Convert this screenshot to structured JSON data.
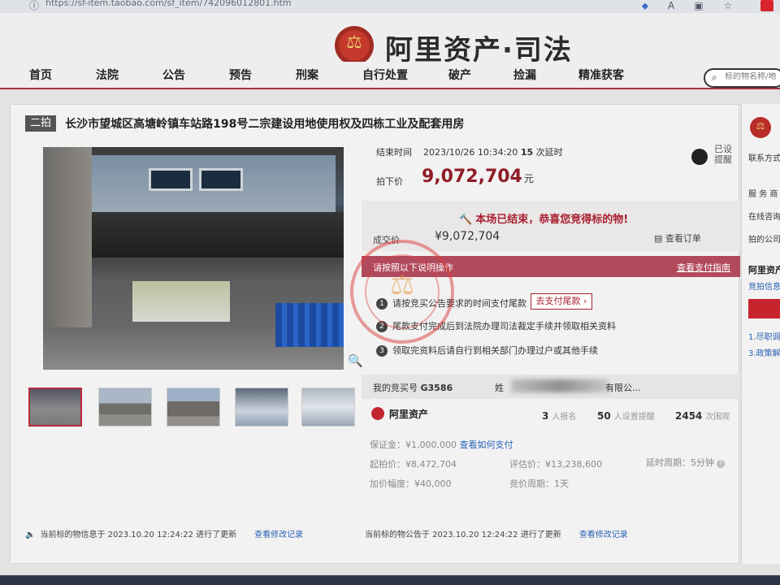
{
  "browser": {
    "url": "https://sf-item.taobao.com/sf_item/742096012801.htm",
    "icons": [
      "key-icon",
      "read-aloud-icon",
      "split-icon",
      "star-icon"
    ]
  },
  "header": {
    "brand": "阿里资产·司法"
  },
  "nav": {
    "items": [
      "首页",
      "法院",
      "公告",
      "预告",
      "刑案",
      "自行处置",
      "破产",
      "捡漏",
      "精准获客"
    ],
    "search_placeholder": "标的物名称/地"
  },
  "item": {
    "round": "二拍",
    "title": "长沙市望城区高塘岭镇车站路198号二宗建设用地使用权及四栋工业及配套用房"
  },
  "auction": {
    "end_label": "结束时间",
    "end_time": "2023/10/26 10:34:20",
    "delay_count": "15",
    "delay_suffix": "次延时",
    "reminder": "已设提醒",
    "hammer_label": "拍下价",
    "hammer_price": "9,072,704",
    "hammer_unit": "元",
    "result_message": "本场已结束，恭喜您竞得标的物!",
    "deal_label": "成交价",
    "deal_price": "¥9,072,704",
    "view_order": "查看订单",
    "instruction": "请按照以下说明操作",
    "payment_guide": "查看支付指南",
    "steps": [
      "请按竞买公告要求的时间支付尾款",
      "尾款支付完成后到法院办理司法裁定手续并领取相关资料",
      "领取完资料后请自行到相关部门办理过户或其他手续"
    ],
    "pay_button": "去支付尾款",
    "bidder_label": "我的竞买号",
    "bidder_no": "G3586",
    "name_label": "姓",
    "name_tail": "有限公..."
  },
  "platform": {
    "name": "阿里资产",
    "signups": "3",
    "signups_label": "人报名",
    "reminders": "50",
    "reminders_label": "人设置提醒",
    "views": "2454",
    "views_label": "次围观"
  },
  "details": {
    "deposit": "保证金：¥1,000,000",
    "how_to_pay": "查看如何支付",
    "start_price": "起拍价：¥8,472,704",
    "appraisal": "评估价：¥13,238,600",
    "delay_period": "延时周期：5分钟",
    "increment": "加价幅度：¥40,000",
    "bid_period": "竞价周期：1天"
  },
  "footer": {
    "info_update": "当前标的物信息于 2023.10.20 12:24:22 进行了更新",
    "notice_update": "当前标的物公告于 2023.10.20 12:24:22 进行了更新",
    "view_changes": "查看修改记录"
  },
  "sidebar": {
    "contact": "联系方式",
    "service": "服 务 商",
    "online": "在线咨询",
    "auction_co": "拍的公司",
    "brand": "阿里资产",
    "auction_info": "竞拍信息",
    "note1": "1.尽职调",
    "note2": "3.政策解"
  },
  "colors": {
    "accent": "#a6323e",
    "price": "#8f1c27",
    "link": "#2a63b6"
  }
}
